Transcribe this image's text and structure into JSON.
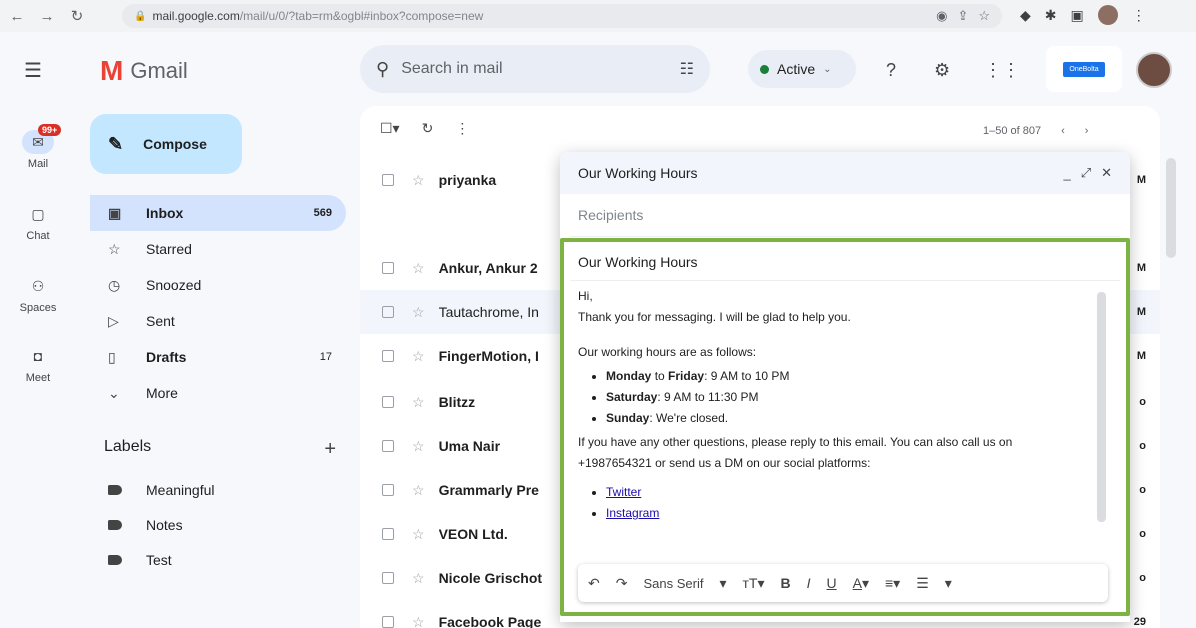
{
  "browser": {
    "url_main": "mail.google.com",
    "url_rest": "/mail/u/0/?tab=rm&ogbl#inbox?compose=new"
  },
  "rail": [
    {
      "label": "Mail",
      "badge": "99+"
    },
    {
      "label": "Chat"
    },
    {
      "label": "Spaces"
    },
    {
      "label": "Meet"
    }
  ],
  "app": {
    "logo": "M",
    "name": "Gmail"
  },
  "search": {
    "placeholder": "Search in mail"
  },
  "status": {
    "label": "Active"
  },
  "brand_chip": "OneBolta",
  "compose_label": "Compose",
  "nav": [
    {
      "label": "Inbox",
      "count": "569"
    },
    {
      "label": "Starred",
      "count": ""
    },
    {
      "label": "Snoozed",
      "count": ""
    },
    {
      "label": "Sent",
      "count": ""
    },
    {
      "label": "Drafts",
      "count": "17"
    },
    {
      "label": "More",
      "count": ""
    }
  ],
  "labels": {
    "title": "Labels",
    "items": [
      "Meaningful",
      "Notes",
      "Test"
    ]
  },
  "pager": "1–50 of 807",
  "mails": [
    {
      "sender": "priyanka",
      "time": "M"
    },
    {
      "sender": "Ankur, Ankur 2",
      "time": "M"
    },
    {
      "sender": "Tautachrome, In",
      "time": "M"
    },
    {
      "sender": "FingerMotion, I",
      "time": "M"
    },
    {
      "sender": "Blitzz",
      "time": "o"
    },
    {
      "sender": "Uma Nair",
      "time": "o"
    },
    {
      "sender": "Grammarly Pre",
      "time": "o"
    },
    {
      "sender": "VEON Ltd.",
      "time": "o"
    },
    {
      "sender": "Nicole Grischot",
      "time": "o"
    },
    {
      "sender": "Facebook Page",
      "time": "29"
    }
  ],
  "compose_window": {
    "title": "Our Working Hours",
    "recipients_placeholder": "Recipients",
    "subject": "Our Working Hours",
    "greeting": "Hi,",
    "line1": "Thank you for messaging. I will be glad to help you.",
    "line2": "Our working hours are as follows:",
    "hours": [
      {
        "day": "Monday",
        "to": "to",
        "day2": "Friday",
        "time": ": 9 AM to 10 PM"
      },
      {
        "day": "Saturday",
        "to": "",
        "day2": "",
        "time": ": 9 AM to 11:30 PM"
      },
      {
        "day": "Sunday",
        "to": "",
        "day2": "",
        "time": ": We're closed."
      }
    ],
    "line3": "If you have any other questions, please reply to this email. You can also call us on +1987654321 or send us a DM on our social platforms:",
    "links": [
      "Twitter",
      "Instagram"
    ],
    "font": "Sans Serif"
  }
}
